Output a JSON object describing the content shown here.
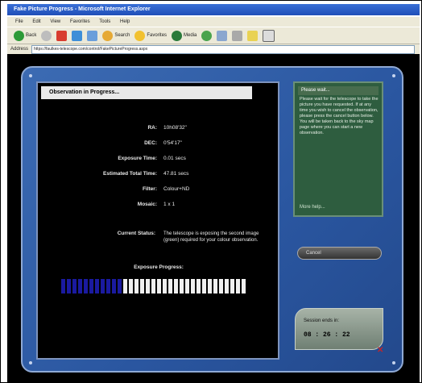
{
  "window": {
    "title": "Fake Picture Progress - Microsoft Internet Explorer"
  },
  "menu": [
    "File",
    "Edit",
    "View",
    "Favorites",
    "Tools",
    "Help"
  ],
  "toolbar": {
    "back_label": "Back",
    "search_label": "Search",
    "favorites_label": "Favorites",
    "media_label": "Media"
  },
  "address": {
    "label": "Address",
    "url": "https://faulkes-telescope.com/control/FakePictureProgress.aspx"
  },
  "observation": {
    "header": "Observation in Progress...",
    "fields": [
      {
        "label": "RA:",
        "value": "10h08'32\""
      },
      {
        "label": "DEC:",
        "value": "0'54'17\""
      },
      {
        "label": "Exposure Time:",
        "value": "0.01 secs"
      },
      {
        "label": "Estimated Total Time:",
        "value": "47.81 secs"
      },
      {
        "label": "Filter:",
        "value": "Colour+ND"
      },
      {
        "label": "Mosaic:",
        "value": "1 x 1"
      }
    ],
    "status_label": "Current Status:",
    "status_text": "The telescope is exposing the second image (green) required for your colour observation.",
    "exposure_label": "Exposure Progress:",
    "progress_fraction": 0.32
  },
  "side_panel": {
    "title": "Please wait...",
    "text": "Please wait for the telescope to take the picture you have requested. If at any time you wish to cancel the observation, please press the cancel button below. You will be taken back to the sky map page where you can start a new observation.",
    "more": "More help..."
  },
  "buttons": {
    "cancel": "Cancel"
  },
  "session": {
    "label": "Session ends in:",
    "time": "08 : 26 : 22"
  },
  "colors": {
    "panel_blue": "#2a56a0",
    "progress_on": "#1a1aa0",
    "progress_off": "#f0f0f0",
    "side_green": "#2e5d3f"
  }
}
